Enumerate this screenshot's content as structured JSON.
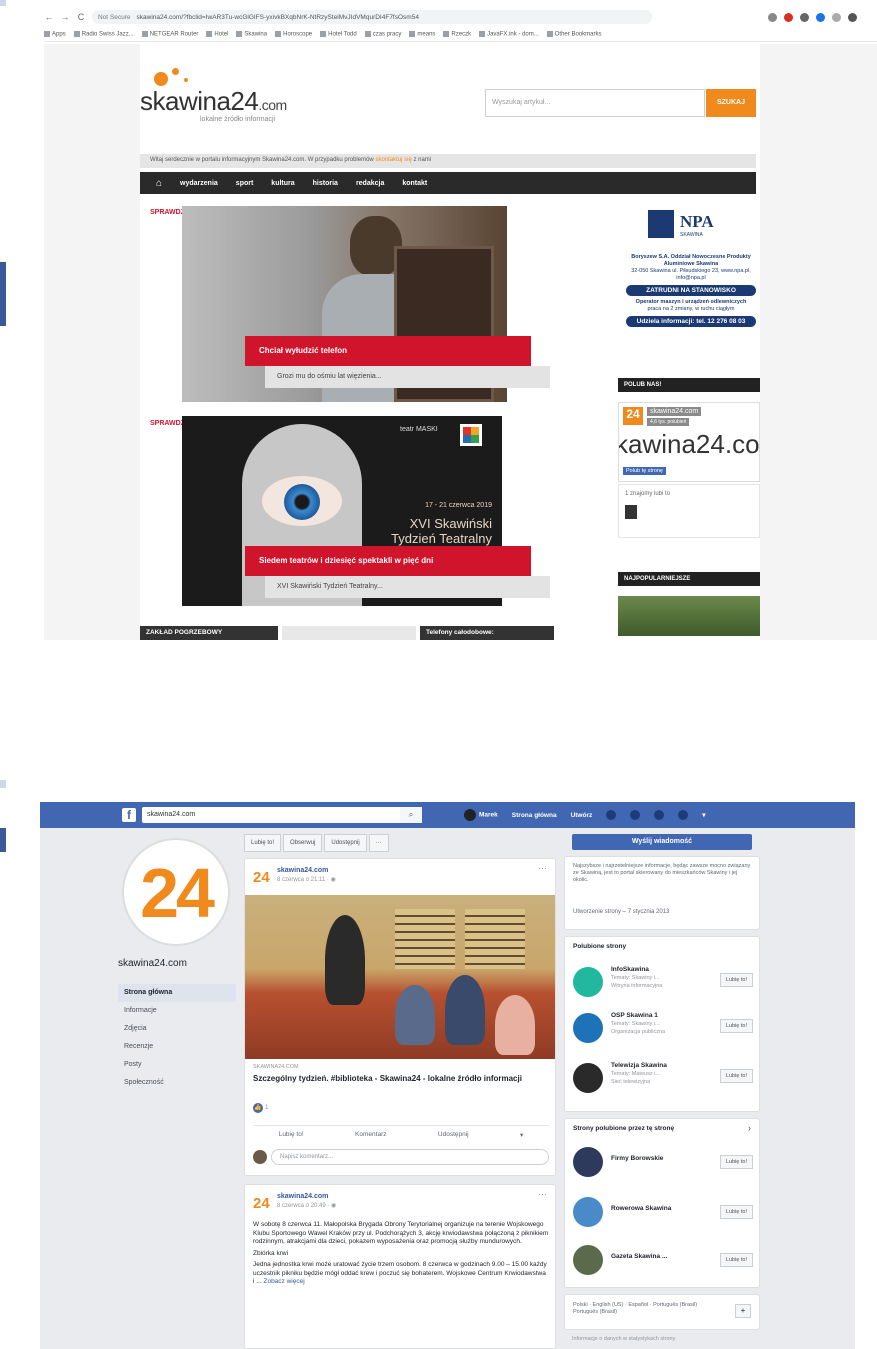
{
  "browser": {
    "back": "←",
    "forward": "→",
    "reload": "C",
    "security": "Not Secure",
    "url": "skawina24.com/?fbclid=IwAR3Tu-wcGlGIFS-yxivkBXqbNrK-NtRzySteiMvJIdVMqurDI4F7fsOsm54",
    "bookmarks": [
      "Apps",
      "Radio Swiss Jazz...",
      "NETGEAR Router",
      "Hotel",
      "Skawina",
      "Horoscope",
      "Hotel Todd",
      "czas pracy",
      "means",
      "Rzeczk",
      "JavaFX.ink - dom...",
      "Other Bookmarks"
    ]
  },
  "site": {
    "logo_main": "skawina24",
    "logo_suffix": ".com",
    "tagline": "lokalne źródło informacji",
    "search_placeholder": "Wyszukaj artykuł...",
    "search_button": "SZUKAJ",
    "info_text": "Witaj serdecznie w portalu informacyjnym Skawina24.com. W przypadku problemów",
    "info_link": "skontaktuj się",
    "info_tail": "z nami",
    "menu": [
      "wydarzenia",
      "sport",
      "kultura",
      "historia",
      "redakcja",
      "kontakt"
    ],
    "badge": "SPRAWDŹ TO!",
    "article1_title": "Chciał wyłudzić telefon",
    "article1_sub": "Grozi mu do ośmiu lat więzienia...",
    "article2_title": "Siedem teatrów i dziesięć spektakli w pięć dni",
    "article2_sub": "XVI Skawiński Tydzień Teatralny...",
    "poster_label": "teatr MASKI",
    "poster_date": "17 - 21 czerwca 2019",
    "poster_title": "XVI Skawiński Tydzień Teatralny",
    "npa_brand": "NPA",
    "npa_sub": "SKAWINA",
    "npa_line1": "Boryszew S.A. Oddział Nowoczesne Produkty Aluminiowe Skawina",
    "npa_line2": "32-050 Skawina ul. Piłsudskiego 23, www.npa.pl, info@npa.pl",
    "npa_btn1": "ZATRUDNI NA STANOWISKO",
    "npa_line3": "Operator maszyn i urządzeń odlewniczych",
    "npa_line4": "praca na 2 zmiany, w ruchu ciągłym",
    "npa_btn2": "Udziela informacji: tel. 12 276 08 03",
    "polub_nas": "POLUB NAS!",
    "fb_widget_name": "skawina24.com",
    "fb_widget_likes": "4,6 tys. polubień",
    "fb_widget_big": "kawina24.co",
    "fb_widget_like": "Polub tę stronę",
    "fb_widget_friends": "1 znajomy lubi to",
    "najpopularniejsze": "NAJPOPULARNIEJSZE",
    "bottom_items": [
      "ZAKŁAD POGRZEBOWY",
      "Telefony całodobowe:"
    ]
  },
  "facebook": {
    "logo": "f",
    "search_value": "skawina24.com",
    "nav_name": "Marek",
    "nav_home": "Strona główna",
    "nav_create": "Utwórz",
    "page_avatar_text": "24",
    "page_name": "skawina24.com",
    "left_nav": [
      "Strona główna",
      "Informacje",
      "Zdjęcia",
      "Recenzje",
      "Posty",
      "Społeczność"
    ],
    "action_buttons": [
      "Lubię to!",
      "Obserwuj",
      "Udostępnij",
      "···"
    ],
    "post1": {
      "avatar": "24",
      "name": "skawina24.com",
      "time": "8 czerwca o 21:11 · ◉",
      "source": "SKAWINA24.COM",
      "title": "Szczególny tydzień. #biblioteka - Skawina24 - lokalne źródło informacji",
      "reactions": "1",
      "btn_like": "Lubię to!",
      "btn_comment": "Komentarz",
      "btn_share": "Udostępnij",
      "comment_placeholder": "Napisz komentarz..."
    },
    "post2": {
      "avatar": "24",
      "name": "skawina24.com",
      "time": "8 czerwca o 20:49 · ◉",
      "p1": "W sobotę 8 czerwca 11. Małopolska Brygada Obrony Terytorialnej organizuje na terenie Wojskowego Klubu Sportowego Wawel Kraków przy ul. Podchorążych 3, akcję krwiodawstwa połączoną z piknikiem rodzinnym, atrakcjami dla dzieci, pokazem wyposażenia oraz promocją służby mundurowych.",
      "p2": "Zbiórka krwi",
      "p3": "Jedna jednostka krwi może uratować życie trzem osobom. 8 czerwca w godzinach 9.00 – 15.00 każdy uczestnik pikniku będzie mógł oddać krew i poczuć się bohaterem. Wojskowe Centrum Krwiodawstwa i ...",
      "more": "Zobacz więcej"
    },
    "send_message": "Wyślij wiadomość",
    "about_text": "Najszybsze i najrzetelniejsze informacje, będąc zawsze mocno związany ze Skawiną, jest to portal skierowany do mieszkańców Skawiny i jej okolic.",
    "about_date": "Utworzenie strony – 7 stycznia 2013",
    "liked_title": "Polubione strony",
    "liked_pages": [
      {
        "name": "InfoSkawina",
        "sub1": "Tematy: Skawiny i...",
        "sub2": "Witryna informacyjna",
        "btn": "Lubię to!",
        "color": "#22b8a0"
      },
      {
        "name": "OSP Skawina 1",
        "sub1": "Tematy: Skawiny i...",
        "sub2": "Organizacja publiczna",
        "btn": "Lubię to!",
        "color": "#1e72b8"
      },
      {
        "name": "Telewizja Skawina",
        "sub1": "Tematy: Mateusz i...",
        "sub2": "Sieć telewizyjna",
        "btn": "Lubię to!",
        "color": "#2a2a2a"
      }
    ],
    "related_title": "Strony polubione przez tę stronę",
    "related_pages": [
      {
        "name": "Firmy Borowskie",
        "btn": "Lubię to!",
        "color": "#2d3a5c"
      },
      {
        "name": "Rowerowa Skawina",
        "btn": "Lubię to!",
        "color": "#4a8ac8"
      },
      {
        "name": "Gazeta Skawina ...",
        "btn": "Lubię to!",
        "color": "#5a6a4a"
      }
    ],
    "lang_line1": "Polski · English (US) · Español · Português (Brasil)",
    "lang_line2": "Português (Brasil)",
    "lang_btn": "+",
    "footer_info": "Informacje o danych w statystykach strony"
  }
}
